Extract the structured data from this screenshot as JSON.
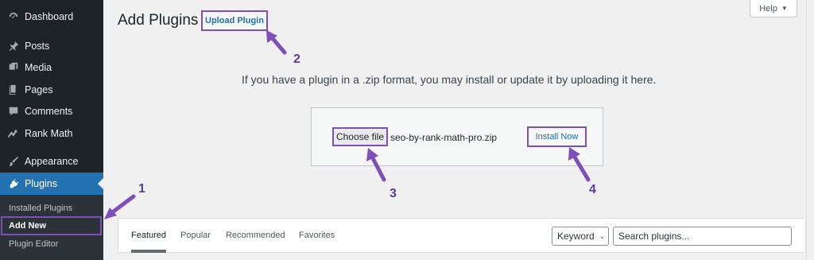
{
  "sidebar": {
    "items": [
      {
        "label": "Dashboard",
        "icon": "dashboard-icon"
      },
      {
        "label": "Posts",
        "icon": "pin-icon"
      },
      {
        "label": "Media",
        "icon": "media-icon"
      },
      {
        "label": "Pages",
        "icon": "pages-icon"
      },
      {
        "label": "Comments",
        "icon": "comments-icon"
      },
      {
        "label": "Rank Math",
        "icon": "rank-math-icon"
      },
      {
        "label": "Appearance",
        "icon": "paintbrush-icon"
      },
      {
        "label": "Plugins",
        "icon": "plugins-icon"
      }
    ],
    "submenu": [
      "Installed Plugins",
      "Add New",
      "Plugin Editor"
    ],
    "active_color": "#2271b1"
  },
  "header": {
    "title": "Add Plugins",
    "upload_button": "Upload Plugin",
    "help": "Help"
  },
  "upload": {
    "description": "If you have a plugin in a .zip format, you may install or update it by uploading it here.",
    "choose_file": "Choose file",
    "file_name": "seo-by-rank-math-pro.zip",
    "install_now": "Install Now"
  },
  "annotations": {
    "step1": "1",
    "step2": "2",
    "step3": "3",
    "step4": "4",
    "color": "#7e4fb8"
  },
  "filter": {
    "tabs": [
      "Featured",
      "Popular",
      "Recommended",
      "Favorites"
    ],
    "keyword": "Keyword",
    "search_placeholder": "Search plugins..."
  }
}
